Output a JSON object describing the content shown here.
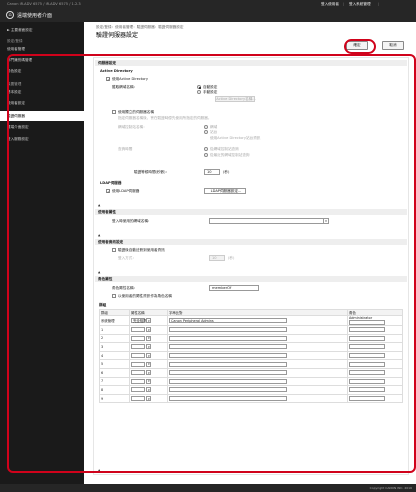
{
  "topbar": {
    "small_text": "Canon iR-ADV 6575 / iR-ADV 6575 / 1.2.3",
    "title": "遠端使用者介面",
    "login_user": "登入使用者",
    "logout": "登入系統管理",
    "sep": "|"
  },
  "sidebar": {
    "items": [
      {
        "label": "► 主要畫面設定"
      },
      {
        "label": "設定/登錄",
        "head": true
      },
      {
        "label": "使用者管理"
      },
      {
        "label": "部門識別碼管理"
      },
      {
        "label": "角色設定"
      },
      {
        "label": "裝置管理",
        "head": true
      },
      {
        "label": "基本設定"
      },
      {
        "label": "使用者設定"
      },
      {
        "label": "驗證伺服器",
        "active": true
      },
      {
        "label": "遠端介面設定"
      },
      {
        "label": "登入服務設定"
      }
    ]
  },
  "main": {
    "breadcrumb": "設定/登錄：使用者管理：驗證伺服器：驗證伺服器設定",
    "title": "驗證伺服器設定",
    "ok_label": "確定",
    "cancel_label": "取消"
  },
  "panel": {
    "section_title": "伺服器設定",
    "ad": {
      "heading": "Active Directory",
      "use_label": "使用Active Directory",
      "retrieve_label": "獲取網域名稱：",
      "auto_label": "自動設定",
      "manual_label": "手動設定",
      "domain_btn": "Active Directory名稱...",
      "specify_label": "使用獨立的伺服器名稱",
      "specify_note": "指定伺服器名稱後，會在驗證時優先使用所指定的伺服器。",
      "name_label": "網域控制站名稱：",
      "retrieve_opt1": "網域",
      "retrieve_opt2": "站台",
      "retrieve_opt2_note": "使用Active Directory站台資訊",
      "query_label": "查詢時間",
      "query_opt1": "從網域控制站查詢",
      "query_opt2": "從最近的網域控制站查詢",
      "query_note": "",
      "timeout_label": "驗證等候時間(秒數)：",
      "timeout_value": "10",
      "timeout_unit": "(秒)"
    },
    "ldap": {
      "heading": "LDAP伺服器",
      "use_label": "使用LDAP伺服器",
      "btn": "LDAP伺服器設定..."
    },
    "mark1": "▲",
    "sec2_bar": "使用者屬性",
    "sec2_label": "登入時使用的網域名稱：",
    "mark2": "▲",
    "sec3_bar": "使用者資訊設定",
    "sec3_check": "驗證後自動註冊到使用者資訊",
    "sec3_label": "登入方式：",
    "sec3_value": "10",
    "sec3_unit": "(秒)",
    "mark3": "▲",
    "sec4_bar": "角色屬性",
    "sec4_attr_label": "角色屬性名稱：",
    "sec4_attr_value": "memberOf",
    "sec4_check": "以使用者的屬性資訊作為角色名稱",
    "groups_label": "群組",
    "cols": [
      "群組",
      "屬性名稱",
      "字串比對",
      "角色"
    ],
    "rows": [
      {
        "c1": "系統管理",
        "c2": "完全相符",
        "c3": "Canon Peripheral Admins",
        "c4": "Administrator"
      },
      {
        "c1": "1",
        "c2": "",
        "c3": "",
        "c4": ""
      },
      {
        "c1": "2",
        "c2": "",
        "c3": "",
        "c4": ""
      },
      {
        "c1": "3",
        "c2": "",
        "c3": "",
        "c4": ""
      },
      {
        "c1": "4",
        "c2": "",
        "c3": "",
        "c4": ""
      },
      {
        "c1": "5",
        "c2": "",
        "c3": "",
        "c4": ""
      },
      {
        "c1": "6",
        "c2": "",
        "c3": "",
        "c4": ""
      },
      {
        "c1": "7",
        "c2": "",
        "c3": "",
        "c4": ""
      },
      {
        "c1": "8",
        "c2": "",
        "c3": "",
        "c4": ""
      },
      {
        "c1": "9",
        "c2": "",
        "c3": "",
        "c4": ""
      }
    ],
    "bottom_mark": "▲"
  },
  "footer": {
    "copyright": "Copyright CANON INC. 2016"
  }
}
